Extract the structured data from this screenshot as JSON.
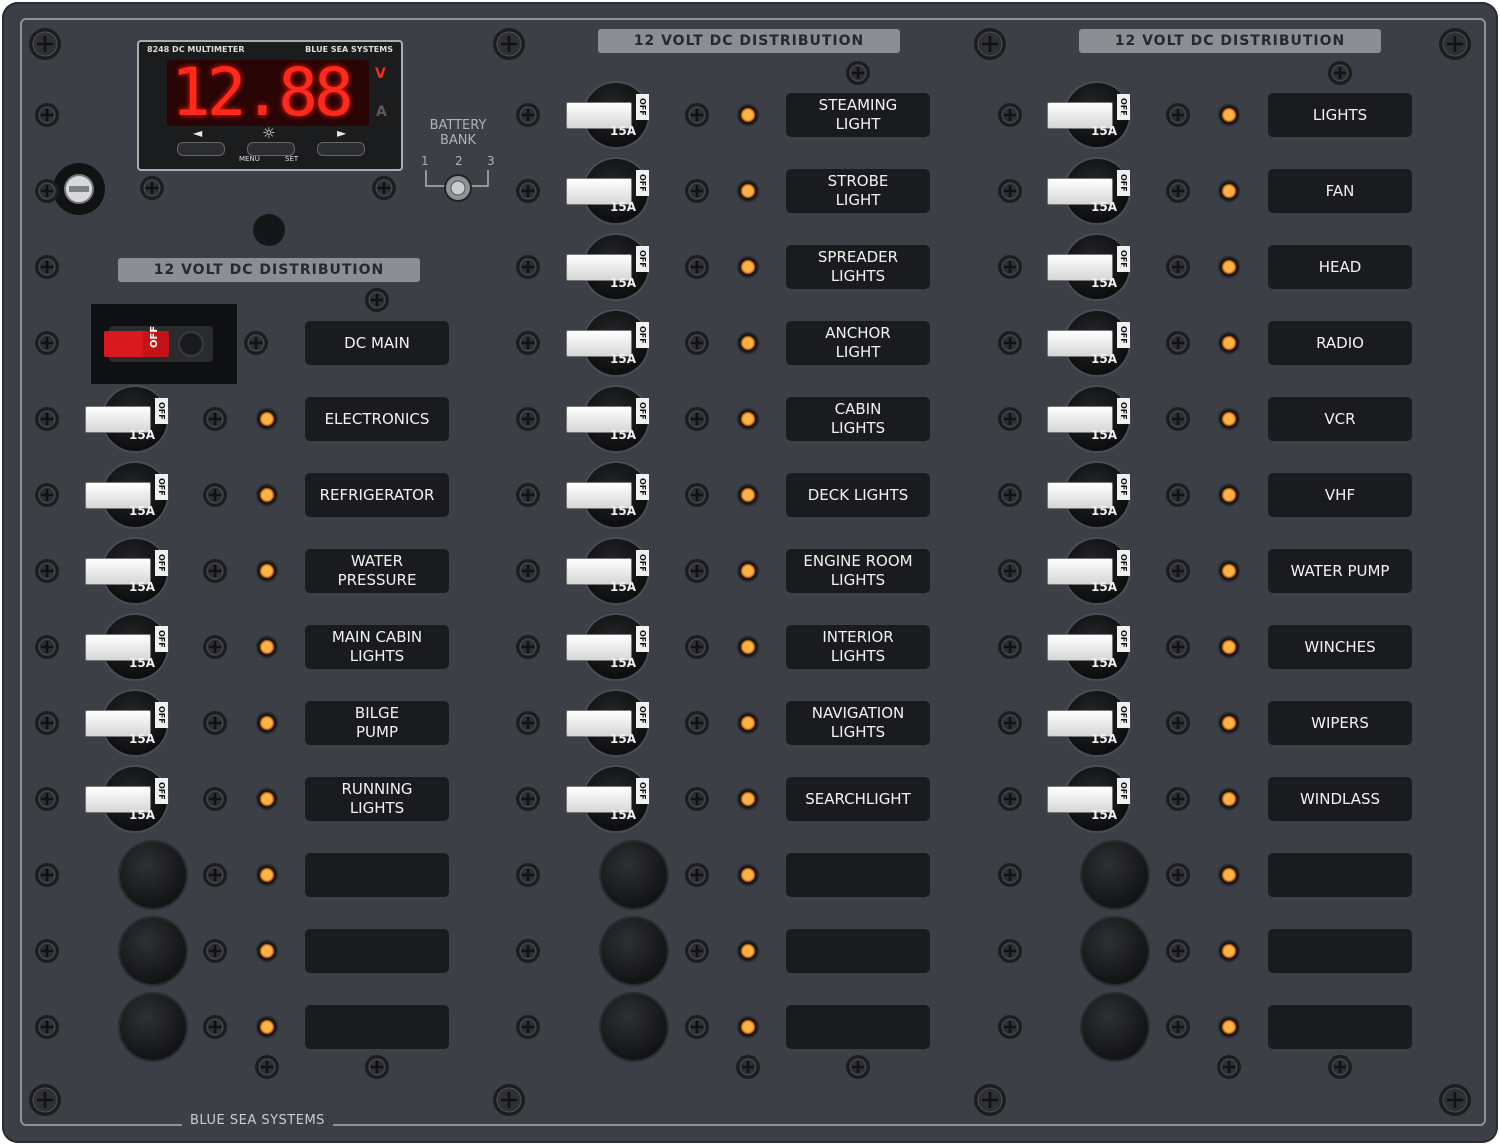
{
  "panel": {
    "brand": "BLUE SEA SYSTEMS"
  },
  "meter": {
    "model": "8248 DC MULTIMETER",
    "maker": "BLUE SEA SYSTEMS",
    "reading": "12.88",
    "unit_v": "V",
    "unit_a": "A",
    "btn_left_symbol": "◄",
    "btn_center_symbol": "☼",
    "btn_right_symbol": "►",
    "menu_label": "MENU",
    "set_label": "SET"
  },
  "battery_bank": {
    "label": "BATTERY\nBANK",
    "positions": [
      "1",
      "2",
      "3"
    ]
  },
  "columns": [
    {
      "title": "12 VOLT DC DISTRIBUTION",
      "main_label": "DC MAIN",
      "main_off_text": "OFF",
      "circuits": [
        "ELECTRONICS",
        "REFRIGERATOR",
        "WATER\nPRESSURE",
        "MAIN CABIN\nLIGHTS",
        "BILGE\nPUMP",
        "RUNNING\nLIGHTS",
        "",
        "",
        ""
      ]
    },
    {
      "title": "12 VOLT DC DISTRIBUTION",
      "circuits": [
        "STEAMING\nLIGHT",
        "STROBE\nLIGHT",
        "SPREADER\nLIGHTS",
        "ANCHOR\nLIGHT",
        "CABIN\nLIGHTS",
        "DECK LIGHTS",
        "ENGINE ROOM\nLIGHTS",
        "INTERIOR\nLIGHTS",
        "NAVIGATION\nLIGHTS",
        "SEARCHLIGHT",
        "",
        "",
        ""
      ]
    },
    {
      "title": "12 VOLT DC DISTRIBUTION",
      "circuits": [
        "LIGHTS",
        "FAN",
        "HEAD",
        "RADIO",
        "VCR",
        "VHF",
        "WATER PUMP",
        "WINCHES",
        "WIPERS",
        "WINDLASS",
        "",
        "",
        ""
      ]
    }
  ],
  "breaker": {
    "rating": "15A",
    "off_text": "OFF"
  },
  "colors": {
    "panel": "#3c4046",
    "label_bg": "#191b1e",
    "led": "#ffb347",
    "display": "#ff2a1c"
  }
}
